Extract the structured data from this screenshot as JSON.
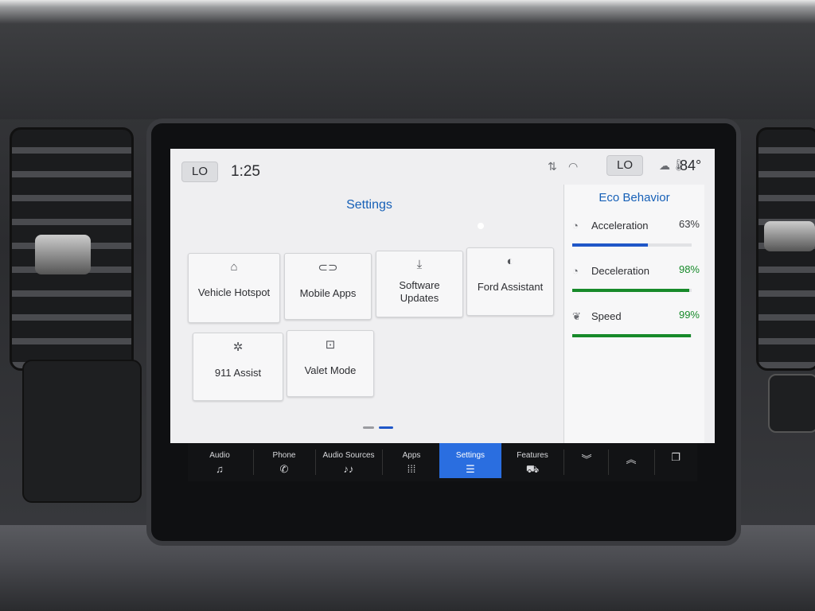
{
  "status_bar": {
    "left_climate": "LO",
    "time": "1:25",
    "right_climate": "LO",
    "temperature": "84°",
    "icons": [
      "data-transfer-icon",
      "wifi-signal-icon",
      "cloudy-icon",
      "thermometer-icon"
    ]
  },
  "settings": {
    "title": "Settings",
    "tiles": [
      {
        "label": "Vehicle Hotspot",
        "icon": "hotspot-car-icon",
        "glyph": "⌂"
      },
      {
        "label": "Mobile Apps",
        "icon": "link-icon",
        "glyph": "⊂⊃"
      },
      {
        "label": "Software Updates",
        "icon": "download-icon",
        "glyph": "⤓"
      },
      {
        "label": "Ford Assistant",
        "icon": "voice-icon",
        "glyph": "◐"
      },
      {
        "label": "911 Assist",
        "icon": "emergency-icon",
        "glyph": "✲"
      },
      {
        "label": "Valet Mode",
        "icon": "valet-lock-icon",
        "glyph": "⊡"
      }
    ],
    "pager": {
      "pages": 2,
      "active": 2
    }
  },
  "eco": {
    "title": "Eco Behavior",
    "metrics": [
      {
        "label": "Acceleration",
        "percent": "63%",
        "value": 0.63,
        "color": "#1f57c8",
        "icon": "gauge-icon"
      },
      {
        "label": "Deceleration",
        "percent": "98%",
        "value": 0.98,
        "color": "#178a2a",
        "icon": "gauge-leaf-icon"
      },
      {
        "label": "Speed",
        "percent": "99%",
        "value": 0.99,
        "color": "#178a2a",
        "icon": "leaf-speed-icon"
      }
    ],
    "percent_color": "#178a2a",
    "accel_percent_color": "#3a3b3f"
  },
  "navbar": {
    "items": [
      {
        "label": "Audio",
        "icon": "♫"
      },
      {
        "label": "Phone",
        "icon": "✆"
      },
      {
        "label": "Audio Sources",
        "icon": "♪♪"
      },
      {
        "label": "Apps",
        "icon": "⁞⁞⁞"
      },
      {
        "label": "Settings",
        "icon": "☰",
        "active": true
      },
      {
        "label": "Features",
        "icon": "⛟"
      },
      {
        "label": "",
        "icon": "︾"
      },
      {
        "label": "",
        "icon": "︽"
      },
      {
        "label": "",
        "icon": "❐"
      }
    ],
    "accent": "#2a6ee0"
  }
}
